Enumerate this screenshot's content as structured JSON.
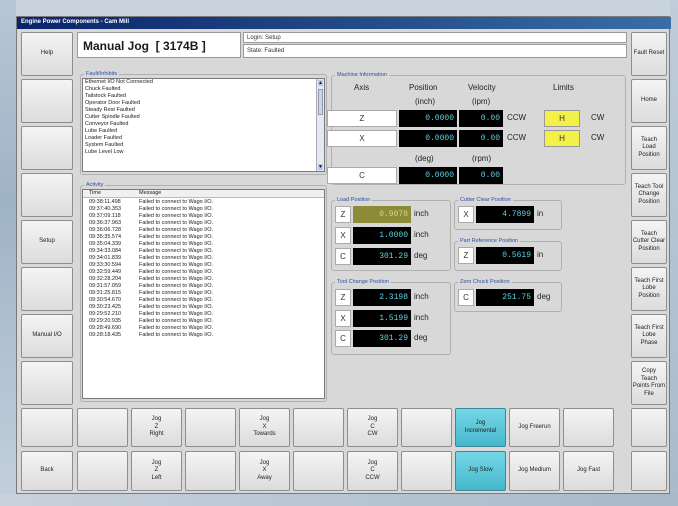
{
  "window": {
    "title": "Engine Power Components - Cam Mill"
  },
  "header": {
    "page_title": "Manual Jog  [ 3174B ]",
    "login": "Login: Setup",
    "state": "State: Faulted"
  },
  "left_buttons": [
    "Help",
    "",
    "",
    "",
    "Setup",
    "",
    "Manual I/O",
    "",
    "",
    "Back"
  ],
  "right_buttons": [
    "Fault Reset",
    "Home",
    "Teach\nLoad\nPosition",
    "Teach Tool\nChange\nPosition",
    "Teach\nCutter Clear\nPosition",
    "Teach First\nLobe\nPosition",
    "Teach First\nLobe\nPhase",
    "Copy\nTeach\nPoints From\nFile",
    ""
  ],
  "fault": {
    "title": "Fault/Inhibits",
    "items": [
      "Ethernet I/O Not Connected",
      "Chuck Faulted",
      "Tailstock Faulted",
      "Operator Door Faulted",
      "Steady Rest Faulted",
      "Cutter Spindle Faulted",
      "Conveyor Faulted",
      "Lube Faulted",
      "Loader Faulted",
      "System Faulted",
      "Lube Level Low"
    ]
  },
  "activity": {
    "title": "Activity",
    "col_time": "Time",
    "col_message": "Message",
    "rows": [
      [
        "09:38:11.498",
        "Failed to connect to Wago I/O."
      ],
      [
        "09:37:40.353",
        "Failed to connect to Wago I/O."
      ],
      [
        "09:37:09.118",
        "Failed to connect to Wago I/O."
      ],
      [
        "09:36:37.963",
        "Failed to connect to Wago I/O."
      ],
      [
        "09:36:06.728",
        "Failed to connect to Wago I/O."
      ],
      [
        "09:35:35.574",
        "Failed to connect to Wago I/O."
      ],
      [
        "09:35:04.339",
        "Failed to connect to Wago I/O."
      ],
      [
        "09:34:33.084",
        "Failed to connect to Wago I/O."
      ],
      [
        "09:34:01.839",
        "Failed to connect to Wago I/O."
      ],
      [
        "09:33:30.594",
        "Failed to connect to Wago I/O."
      ],
      [
        "09:32:59.449",
        "Failed to connect to Wago I/O."
      ],
      [
        "09:32:28.204",
        "Failed to connect to Wago I/O."
      ],
      [
        "09:31:57.059",
        "Failed to connect to Wago I/O."
      ],
      [
        "09:31:25.815",
        "Failed to connect to Wago I/O."
      ],
      [
        "09:30:54.670",
        "Failed to connect to Wago I/O."
      ],
      [
        "09:30:23.425",
        "Failed to connect to Wago I/O."
      ],
      [
        "09:29:52.210",
        "Failed to connect to Wago I/O."
      ],
      [
        "09:29:20.935",
        "Failed to connect to Wago I/O."
      ],
      [
        "09:28:49.690",
        "Failed to connect to Wago I/O."
      ],
      [
        "09:28:18.435",
        "Failed to connect to Wago I/O."
      ]
    ]
  },
  "machine": {
    "title": "Machine Information",
    "h_axis": "Axis",
    "h_pos": "Position",
    "h_vel": "Velocity",
    "h_lim": "Limits",
    "u_pos": "(inch)",
    "u_vel": "(ipm)",
    "u_pos2": "(deg)",
    "u_vel2": "(rpm)",
    "z": {
      "axis": "Z",
      "pos": "0.0000",
      "vel": "0.00",
      "ccw": "CCW",
      "h": "H",
      "cw": "CW"
    },
    "x": {
      "axis": "X",
      "pos": "0.0000",
      "vel": "0.00",
      "ccw": "CCW",
      "h": "H",
      "cw": "CW"
    },
    "c": {
      "axis": "C",
      "pos": "0.0000",
      "vel": "0.00"
    }
  },
  "load": {
    "title": "Load Position",
    "z": "0.9078",
    "x": "1.0000",
    "c": "301.29",
    "in": "inch",
    "deg": "deg",
    "az": "Z",
    "ax": "X",
    "ac": "C"
  },
  "tool": {
    "title": "Tool Change Position",
    "z": "2.3198",
    "x": "1.5199",
    "c": "301.29",
    "in": "inch",
    "deg": "deg",
    "az": "Z",
    "ax": "X",
    "ac": "C"
  },
  "cutter": {
    "title": "Cutter Clear Position",
    "ax": "X",
    "x": "4.7899",
    "unit": "in"
  },
  "partref": {
    "title": "Part Reference Position",
    "az": "Z",
    "z": "0.5619",
    "unit": "in"
  },
  "zerochuck": {
    "title": "Zero Chuck Position",
    "ac": "C",
    "c": "251.75",
    "unit": "deg"
  },
  "jog_top": [
    "",
    "Jog\nZ\nRight",
    "",
    "Jog\nX\nTowards",
    "",
    "Jog\nC\nCW",
    "",
    "",
    "Jog\nIncremental",
    "Jog Freerun",
    ""
  ],
  "jog_bot": [
    "",
    "Jog\nZ\nLeft",
    "",
    "Jog\nX\nAway",
    "",
    "Jog\nC\nCCW",
    "",
    "",
    "Jog Slow",
    "Jog Medium",
    "Jog Fast"
  ],
  "colors": {
    "active": "#46b8cc",
    "readout": "#5fd3e6",
    "limit": "#f4f04a"
  }
}
